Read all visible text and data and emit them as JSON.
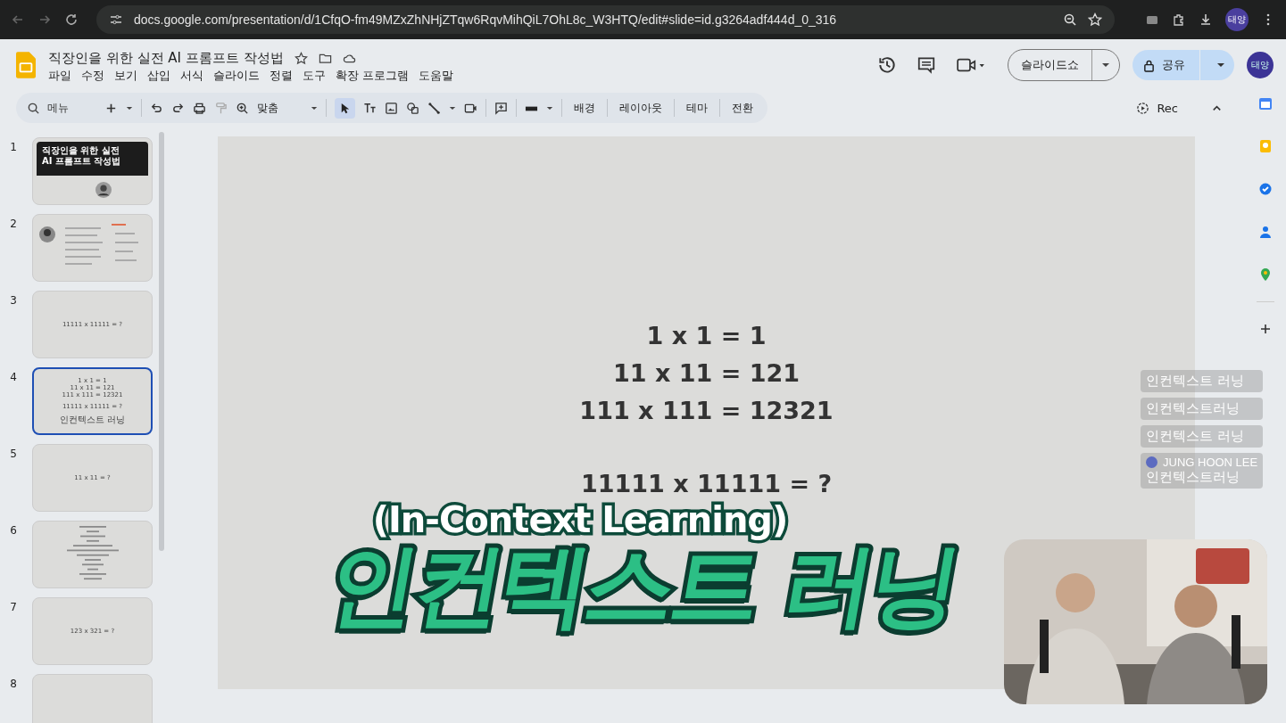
{
  "browser": {
    "url": "docs.google.com/presentation/d/1CfqO-fm49MZxZhNHjZTqw6RqvMihQiL7OhL8c_W3HTQ/edit#slide=id.g3264adf444d_0_316",
    "profile": "태양"
  },
  "document": {
    "title": "직장인을 위한 실전 AI 프롬프트 작성법",
    "menu": [
      "파일",
      "수정",
      "보기",
      "삽입",
      "서식",
      "슬라이드",
      "정렬",
      "도구",
      "확장 프로그램",
      "도움말"
    ],
    "slideshow_button": "슬라이드쇼",
    "share_button": "공유",
    "avatar": "태양"
  },
  "toolbar": {
    "search_placeholder": "메뉴",
    "zoom": "맞춤",
    "buttons": [
      "배경",
      "레이아웃",
      "테마",
      "전환"
    ],
    "rec": "Rec"
  },
  "slides": [
    {
      "number": "1",
      "kind": "title",
      "selected": false,
      "title": "직장인을 위한 실전 AI 프롬프트 작성법"
    },
    {
      "number": "2",
      "kind": "profile",
      "selected": false
    },
    {
      "number": "3",
      "kind": "text",
      "selected": false,
      "blocks": [
        [
          "11111 x 11111 = ?"
        ]
      ]
    },
    {
      "number": "4",
      "kind": "text",
      "selected": true,
      "blocks": [
        [
          "1 x 1 = 1",
          "11 x 11 = 121",
          "111 x 111 = 12321"
        ],
        [
          "11111 x 11111 = ?"
        ],
        [
          "인컨텍스트 러닝"
        ]
      ]
    },
    {
      "number": "5",
      "kind": "text",
      "selected": false,
      "blocks": [
        [
          "11 x 11 = ?"
        ]
      ]
    },
    {
      "number": "6",
      "kind": "dense",
      "selected": false
    },
    {
      "number": "7",
      "kind": "text",
      "selected": false,
      "blocks": [
        [
          "123 x 321 = ?"
        ]
      ]
    },
    {
      "number": "8",
      "kind": "blank",
      "selected": false
    }
  ],
  "canvas": {
    "blocks": [
      [
        "1 x 1 = 1",
        "11 x 11 = 121",
        "111 x 111 = 12321"
      ],
      [
        "11111 x 11111 = ?"
      ]
    ]
  },
  "caption": {
    "subtitle": "(In-Context Learning)",
    "title": "인컨텍스트 러닝"
  },
  "chat": [
    {
      "text": "인컨텍스트 러닝"
    },
    {
      "text": "인컨텍스트러닝"
    },
    {
      "text": "인컨텍스트 러닝"
    },
    {
      "author": "JUNG HOON LEE",
      "text": "인컨텍스트러닝"
    }
  ]
}
